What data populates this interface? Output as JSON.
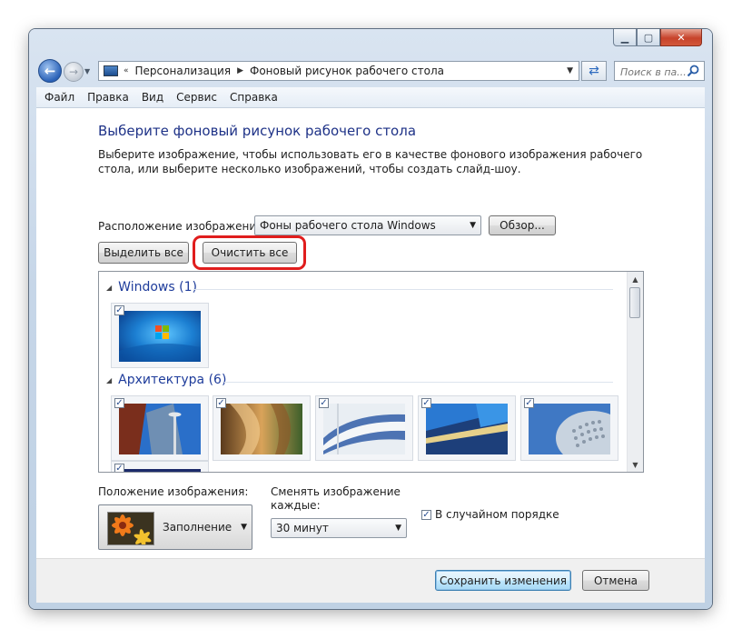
{
  "breadcrumb": {
    "items": [
      "Персонализация",
      "Фоновый рисунок рабочего стола"
    ]
  },
  "search": {
    "placeholder": "Поиск в па..."
  },
  "menu": {
    "items": [
      "Файл",
      "Правка",
      "Вид",
      "Сервис",
      "Справка"
    ]
  },
  "main": {
    "title": "Выберите фоновый рисунок рабочего стола",
    "description": "Выберите изображение, чтобы использовать его в качестве фонового изображения рабочего стола, или выберите несколько изображений, чтобы создать слайд-шоу.",
    "location_label": "Расположение изображения:",
    "location_value": "Фоны рабочего стола Windows",
    "browse_label": "Обзор...",
    "select_all_label": "Выделить все",
    "clear_all_label": "Очистить все",
    "highlight_color": "#e01d1d"
  },
  "gallery": {
    "groups": [
      {
        "name": "Windows (1)",
        "thumbs": [
          {
            "checked": true,
            "art": "windows-logo"
          }
        ]
      },
      {
        "name": "Архитектура (6)",
        "thumbs": [
          {
            "checked": true,
            "art": "arch-1"
          },
          {
            "checked": true,
            "art": "arch-2"
          },
          {
            "checked": true,
            "art": "arch-3"
          },
          {
            "checked": true,
            "art": "arch-4"
          },
          {
            "checked": true,
            "art": "arch-5"
          },
          {
            "checked": true,
            "art": "arch-6"
          }
        ]
      }
    ]
  },
  "options": {
    "position_label": "Положение изображения:",
    "position_value": "Заполнение",
    "change_label": "Сменять изображение каждые:",
    "interval_value": "30 минут",
    "random_label": "В случайном порядке",
    "random_checked": true
  },
  "footer": {
    "save_label": "Сохранить изменения",
    "cancel_label": "Отмена"
  },
  "colors": {
    "accent": "#1e3287",
    "group_heading": "#1e3c9b"
  }
}
